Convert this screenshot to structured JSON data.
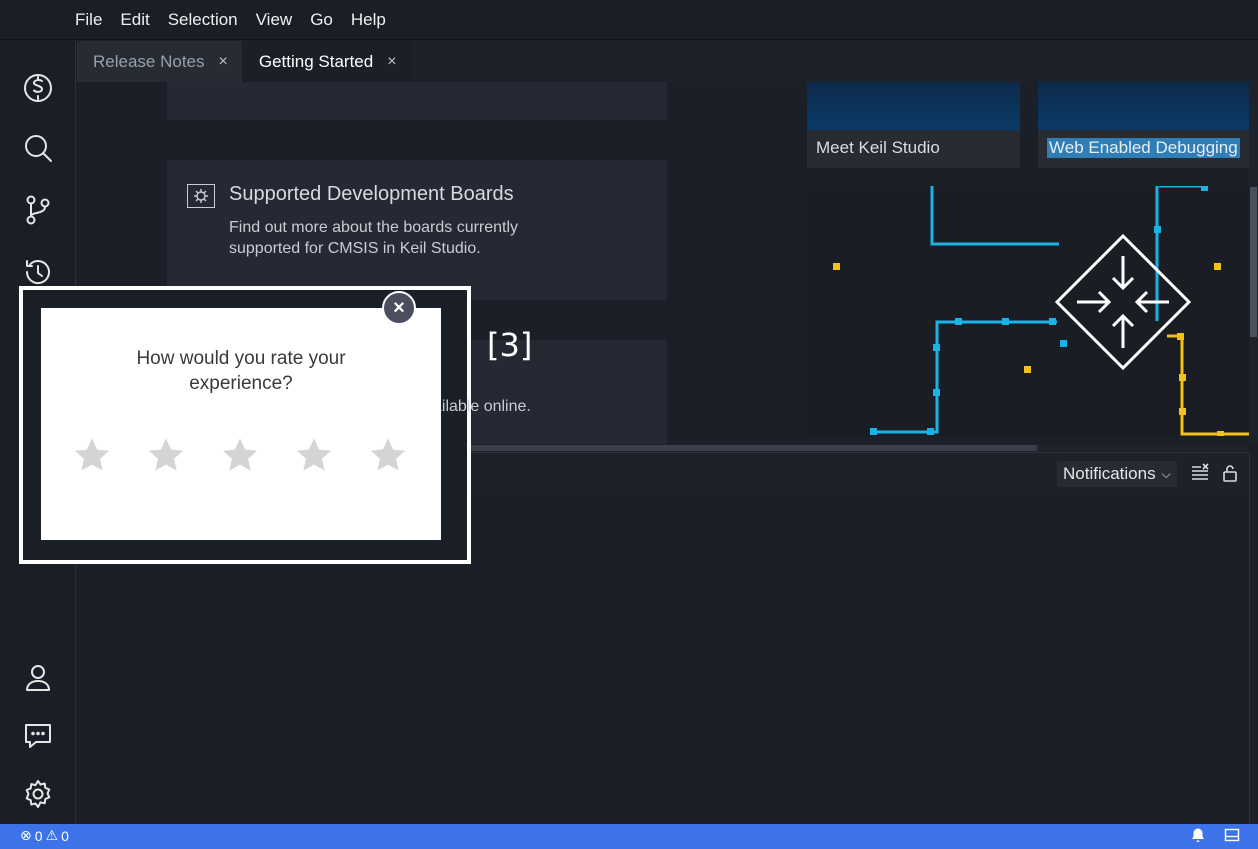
{
  "menubar": {
    "items": [
      "File",
      "Edit",
      "Selection",
      "View",
      "Go",
      "Help"
    ]
  },
  "tabs": [
    {
      "label": "Release Notes",
      "active": false
    },
    {
      "label": "Getting Started",
      "active": true
    }
  ],
  "editor": {
    "boards_card": {
      "title": "Supported Development Boards",
      "desc_line1": "Find out more about the boards currently",
      "desc_line2": "supported for CMSIS in Keil Studio."
    },
    "partial_text": "ailable online.",
    "videos": [
      {
        "label": "Meet Keil Studio",
        "selected": false
      },
      {
        "label": "Web Enabled Debugging",
        "selected": true
      }
    ]
  },
  "callout": "[3]",
  "panel": {
    "close": "×",
    "notifications_select": "Notifications"
  },
  "rating_dialog": {
    "question": "How would you rate your experience?",
    "stars": 5,
    "close": "×"
  },
  "statusbar": {
    "errors": "0",
    "warnings": "0"
  },
  "colors": {
    "accent_statusbar": "#3d73e8",
    "selection": "#2f7fb6",
    "circuit_blue": "#19b3e6",
    "circuit_yellow": "#f2c21a"
  }
}
